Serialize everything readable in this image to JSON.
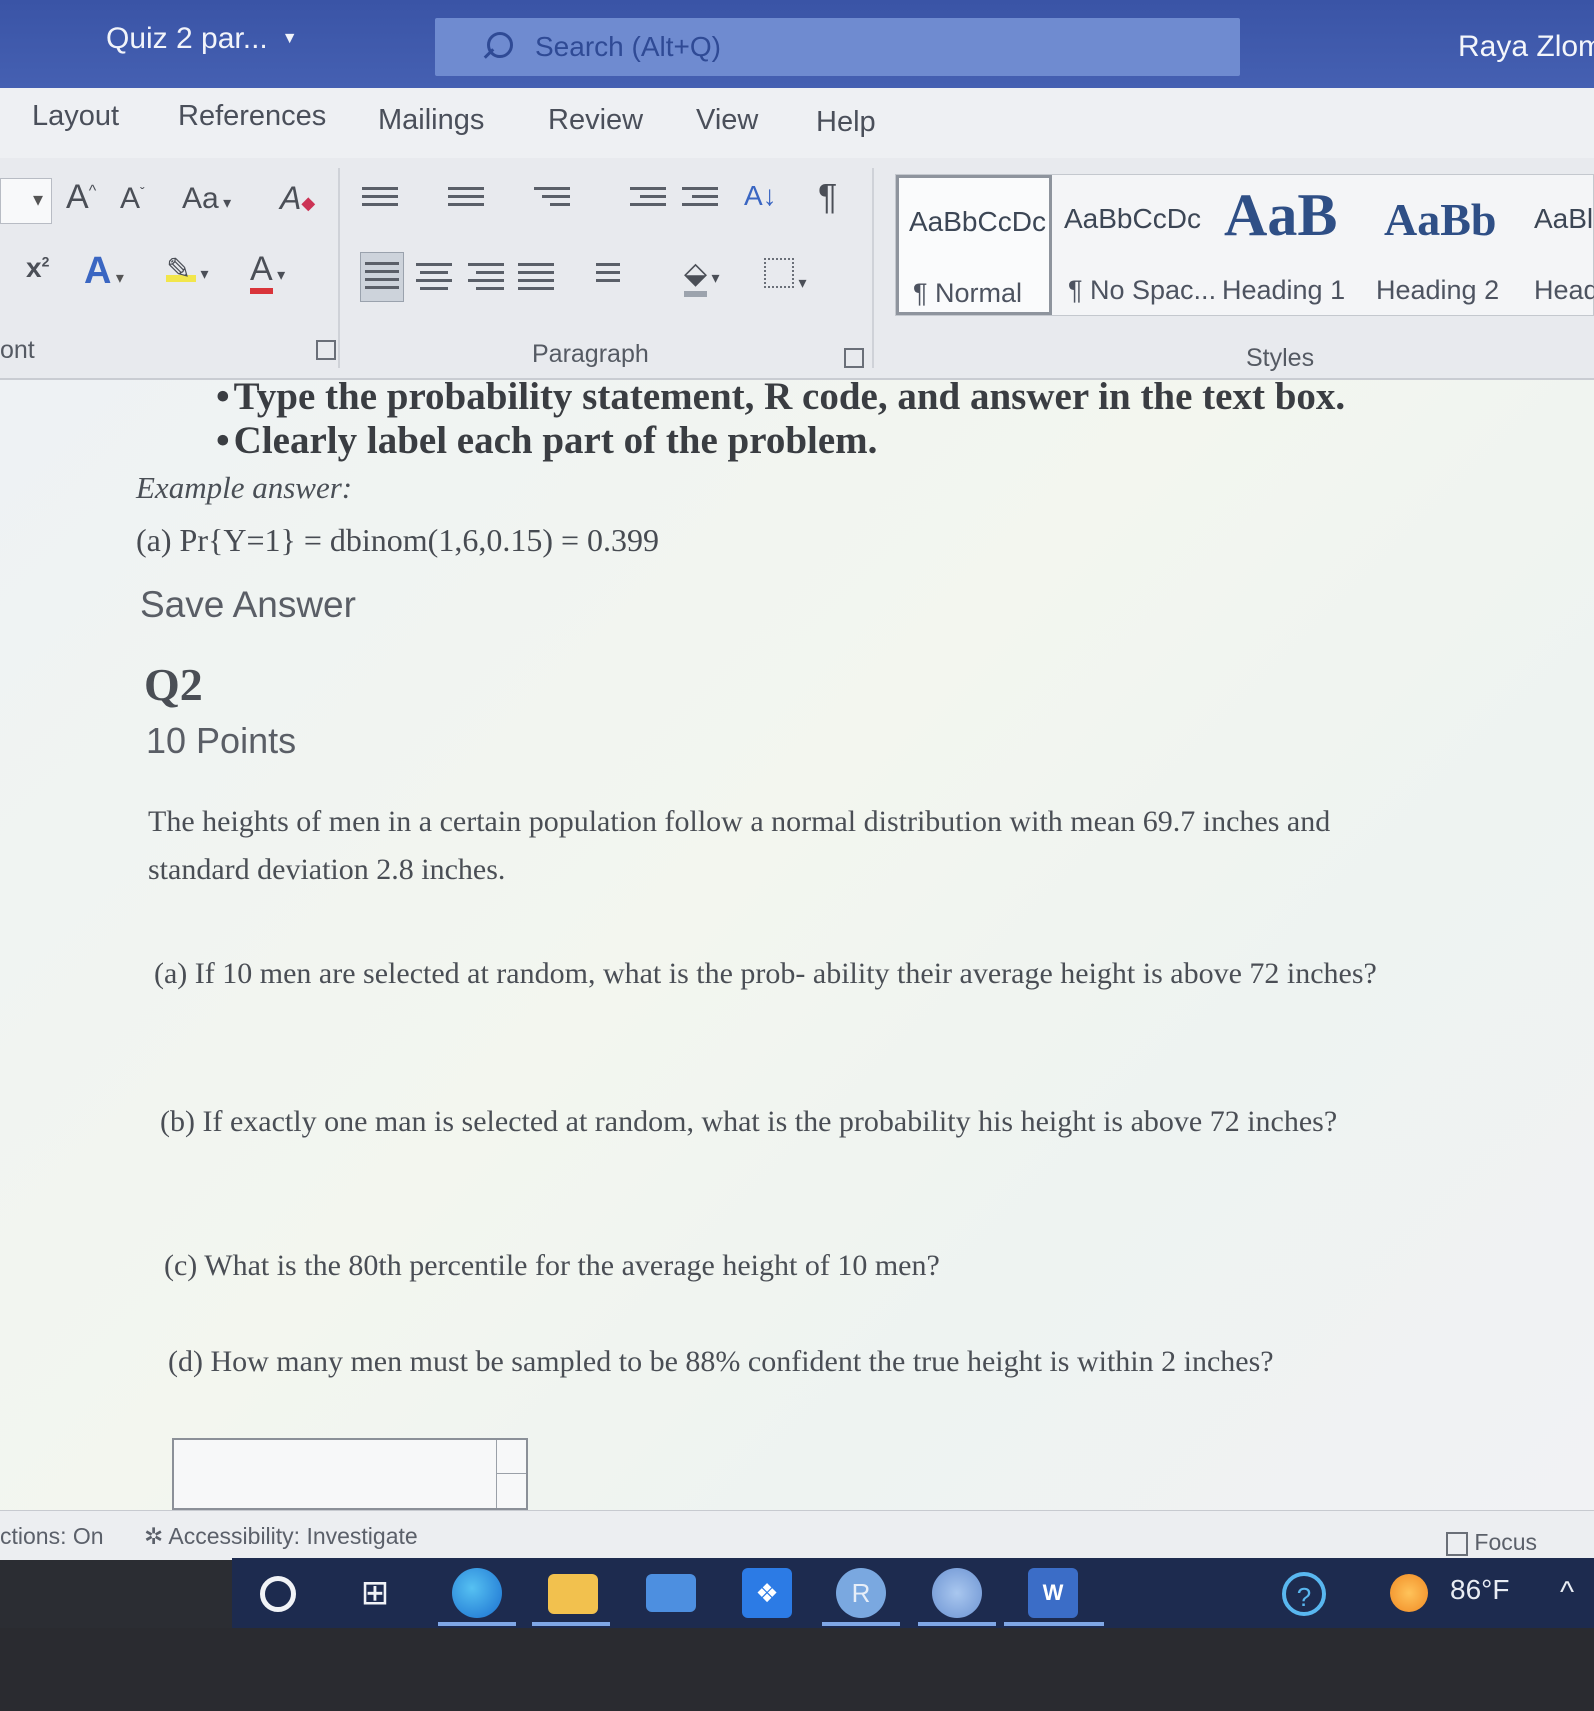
{
  "titlebar": {
    "doc_title": "Quiz 2 par...",
    "search_placeholder": "Search (Alt+Q)",
    "user_name": "Raya Zlomk"
  },
  "ribbon_tabs": [
    "Layout",
    "References",
    "Mailings",
    "Review",
    "View",
    "Help"
  ],
  "ribbon": {
    "font_group_label": "ont",
    "paragraph_group_label": "Paragraph",
    "styles_group_label": "Styles",
    "font_buttons": {
      "grow": "A",
      "shrink": "A",
      "change_case": "Aa",
      "clear_formatting": "A",
      "superscript": "x",
      "text_effects": "A",
      "font_color": "A"
    },
    "show_marks": "¶",
    "sort": "A↓",
    "styles": [
      {
        "sample": "AaBbCcDc",
        "name": "¶ Normal"
      },
      {
        "sample": "AaBbCcDc",
        "name": "¶ No Spac..."
      },
      {
        "sample": "AaB",
        "name": "Heading 1"
      },
      {
        "sample": "AaBb",
        "name": "Heading 2"
      },
      {
        "sample": "AaBl",
        "name": "Head"
      }
    ]
  },
  "document": {
    "bullets": [
      "Type the probability statement, R code, and answer in the text box.",
      "Clearly label each part of the problem."
    ],
    "example_label": "Example answer:",
    "example_line": "(a) Pr{Y=1} = dbinom(1,6,0.15) = 0.399",
    "save_answer": "Save Answer",
    "question_title": "Q2",
    "question_points": "10 Points",
    "intro": "The heights of men in a certain population follow a normal distribution with mean 69.7 inches and standard deviation 2.8 inches.",
    "parts": [
      "(a) If 10 men are selected at random, what is the prob- ability their average height is above 72 inches?",
      "(b) If exactly one man is selected at random, what is the probability his height is above 72 inches?",
      "(c) What is the 80th percentile for the average height of 10 men?",
      "(d) How many men must be sampled to be 88% confident the true height is within 2 inches?"
    ]
  },
  "statusbar": {
    "predictions": "ctions: On",
    "accessibility": "Accessibility: Investigate",
    "focus": "Focus"
  },
  "taskbar": {
    "temperature": "86°F"
  }
}
